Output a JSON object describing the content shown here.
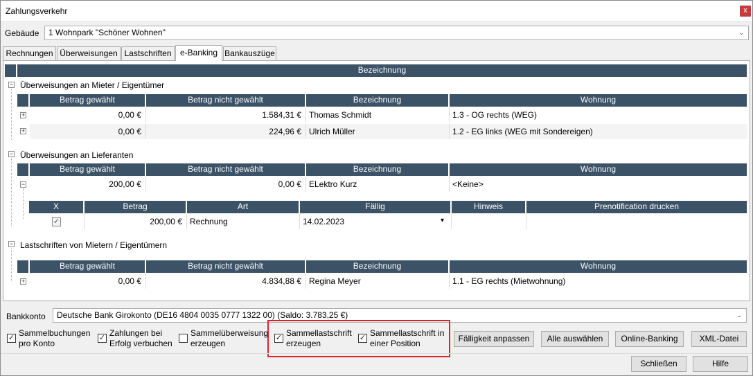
{
  "window": {
    "title": "Zahlungsverkehr",
    "close_label": "x"
  },
  "gebaeude": {
    "label": "Gebäude",
    "value": "1 Wohnpark \"Schöner Wohnen\""
  },
  "tabs": [
    {
      "label": "Rechnungen"
    },
    {
      "label": "Überweisungen"
    },
    {
      "label": "Lastschriften"
    },
    {
      "label": "e-Banking"
    },
    {
      "label": "Bankauszüge"
    }
  ],
  "grid": {
    "top_header": "Bezeichnung",
    "columns": {
      "betrag_gewaehlt": "Betrag gewählt",
      "betrag_nicht_gewaehlt": "Betrag nicht gewählt",
      "bezeichnung": "Bezeichnung",
      "wohnung": "Wohnung"
    },
    "groups": {
      "mieter": {
        "title": "Überweisungen an Mieter / Eigentümer",
        "rows": [
          {
            "gewaehlt": "0,00 €",
            "nicht_gewaehlt": "1.584,31 €",
            "bezeichnung": "Thomas Schmidt",
            "wohnung": "1.3 - OG rechts (WEG)"
          },
          {
            "gewaehlt": "0,00 €",
            "nicht_gewaehlt": "224,96 €",
            "bezeichnung": "Ulrich Müller",
            "wohnung": "1.2 - EG links (WEG mit Sondereigen)"
          }
        ]
      },
      "lieferanten": {
        "title": "Überweisungen an Lieferanten",
        "rows": [
          {
            "gewaehlt": "200,00 €",
            "nicht_gewaehlt": "0,00 €",
            "bezeichnung": "ELektro Kurz",
            "wohnung": "<Keine>"
          }
        ],
        "detail": {
          "columns": {
            "x": "X",
            "betrag": "Betrag",
            "art": "Art",
            "faellig": "Fällig",
            "hinweis": "Hinweis",
            "prenotification": "Prenotification drucken"
          },
          "rows": [
            {
              "checked": "✓",
              "betrag": "200,00 €",
              "art": "Rechnung",
              "faellig": "14.02.2023",
              "hinweis": "",
              "prenotification": ""
            }
          ]
        }
      },
      "lastschriften": {
        "title": "Lastschriften von Mietern / Eigentümern",
        "rows": [
          {
            "gewaehlt": "0,00 €",
            "nicht_gewaehlt": "4.834,88 €",
            "bezeichnung": "Regina Meyer",
            "wohnung": "1.1 - EG rechts (Mietwohnung)"
          }
        ]
      }
    }
  },
  "bankkonto": {
    "label": "Bankkonto",
    "value": "Deutsche Bank Girokonto (DE16 4804 0035 0777 1322 00) (Saldo: 3.783,25 €)"
  },
  "options": [
    {
      "line1": "Sammelbuchungen",
      "line2": "pro Konto",
      "checked": "✓"
    },
    {
      "line1": "Zahlungen bei",
      "line2": "Erfolg verbuchen",
      "checked": "✓"
    },
    {
      "line1": "Sammelüberweisung",
      "line2": "erzeugen",
      "checked": ""
    },
    {
      "line1": "Sammellastschrift",
      "line2": "erzeugen",
      "checked": "✓"
    },
    {
      "line1": "Sammellastschrift in",
      "line2": "einer Position",
      "checked": "✓"
    }
  ],
  "buttons": {
    "faelligkeit": "Fälligkeit anpassen",
    "alle_auswaehlen": "Alle auswählen",
    "online_banking": "Online-Banking",
    "xml_datei": "XML-Datei",
    "schliessen": "Schließen",
    "hilfe": "Hilfe"
  },
  "icons": {
    "expand": "+",
    "collapse": "−",
    "dropdown": "⌄",
    "date_dropdown": "▾"
  }
}
